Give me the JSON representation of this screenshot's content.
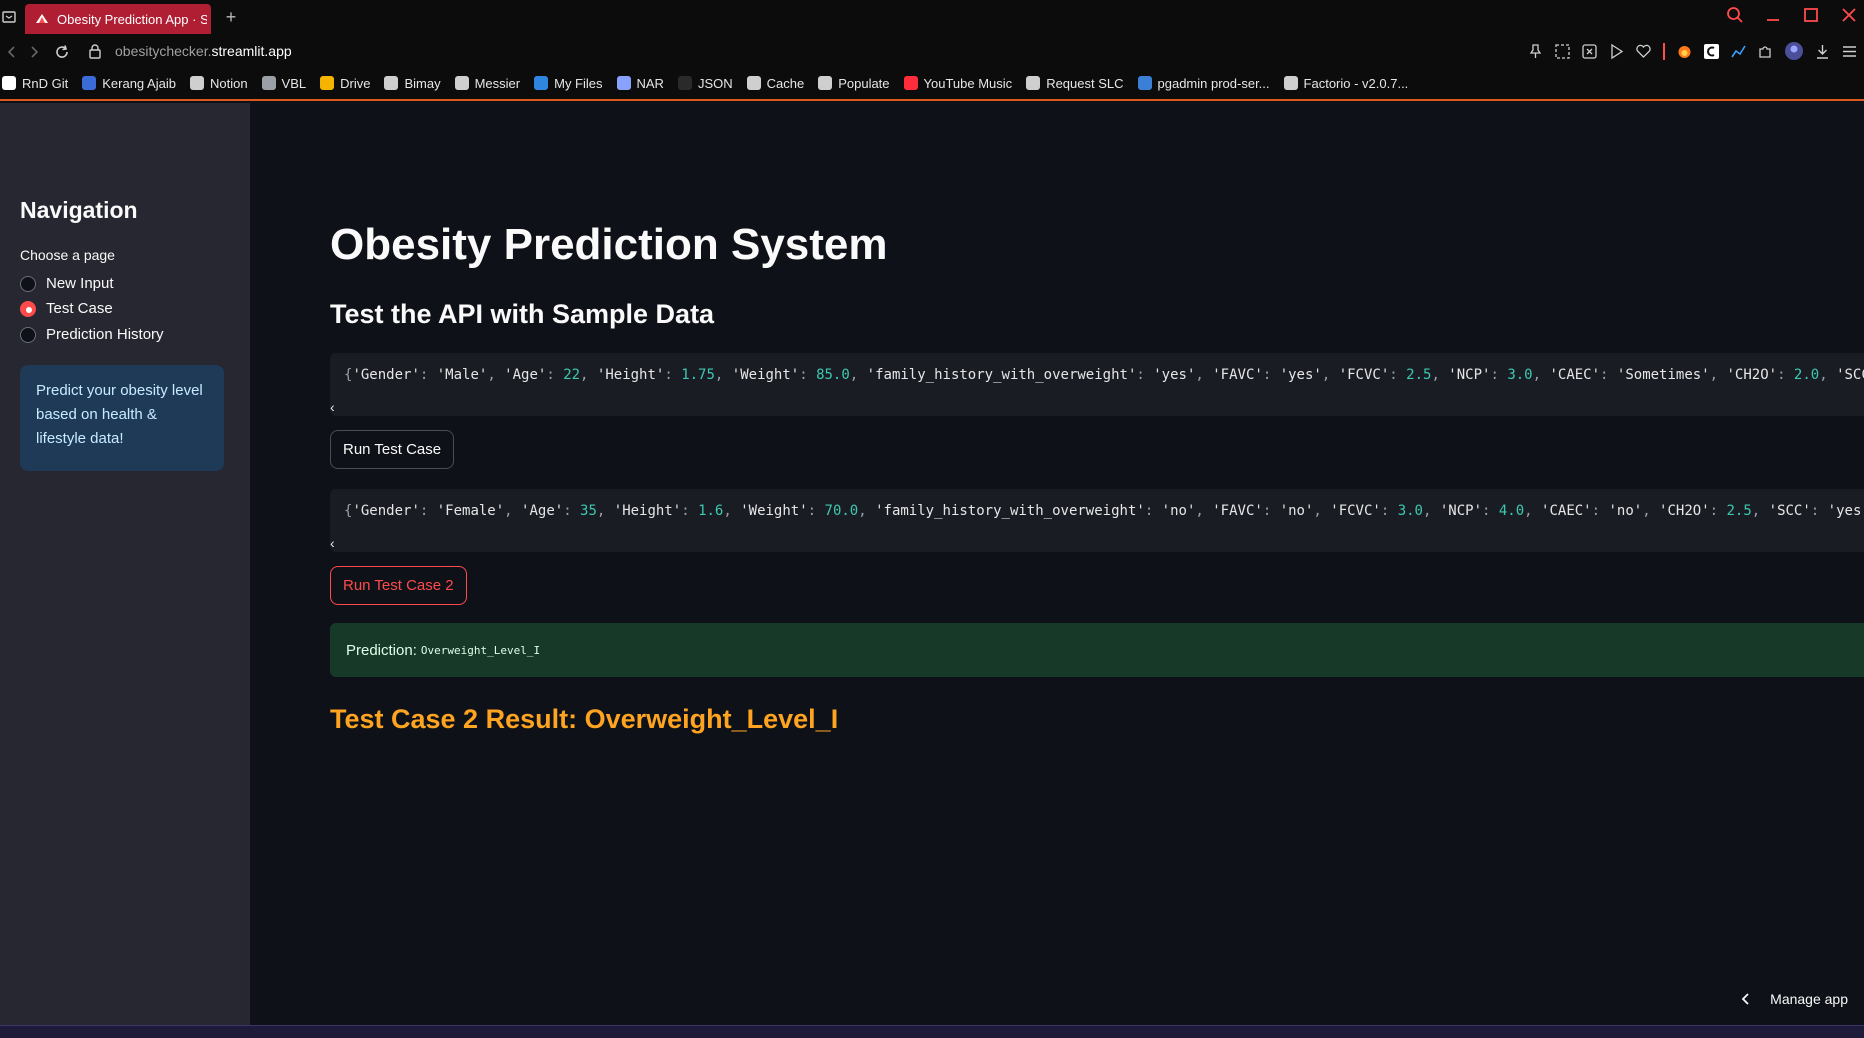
{
  "browser": {
    "tab_title": "Obesity Prediction App · S",
    "new_tab": "+",
    "url_host": "obesitychecker.",
    "url_domain": "streamlit.app",
    "bookmarks": [
      {
        "label": "RnD Git",
        "icon": "github-icon",
        "color": "#ffffff"
      },
      {
        "label": "Kerang Ajaib",
        "icon": "app-icon",
        "color": "#3b6bd6"
      },
      {
        "label": "Notion",
        "icon": "home-icon",
        "color": "#cfcfcf"
      },
      {
        "label": "VBL",
        "icon": "cube-icon",
        "color": "#9aa0a6"
      },
      {
        "label": "Drive",
        "icon": "drive-icon",
        "color": "#f4b400"
      },
      {
        "label": "Bimay",
        "icon": "globe-icon",
        "color": "#cfcfcf"
      },
      {
        "label": "Messier",
        "icon": "globe-icon",
        "color": "#cfcfcf"
      },
      {
        "label": "My Files",
        "icon": "cloud-icon",
        "color": "#2f86e0"
      },
      {
        "label": "NAR",
        "icon": "gear-icon",
        "color": "#8aa2ff"
      },
      {
        "label": "JSON",
        "icon": "json-icon",
        "color": "#2a2a2a"
      },
      {
        "label": "Cache",
        "icon": "globe-icon",
        "color": "#cfcfcf"
      },
      {
        "label": "Populate",
        "icon": "globe-icon",
        "color": "#cfcfcf"
      },
      {
        "label": "YouTube Music",
        "icon": "youtube-music-icon",
        "color": "#ff2d3b"
      },
      {
        "label": "Request SLC",
        "icon": "globe-icon",
        "color": "#cfcfcf"
      },
      {
        "label": "pgadmin prod-ser...",
        "icon": "pgadmin-icon",
        "color": "#3b7fd6"
      },
      {
        "label": "Factorio - v2.0.7...",
        "icon": "file-icon",
        "color": "#cfcfcf"
      }
    ]
  },
  "sidebar": {
    "title": "Navigation",
    "choose_label": "Choose a page",
    "options": [
      {
        "label": "New Input",
        "selected": false
      },
      {
        "label": "Test Case",
        "selected": true
      },
      {
        "label": "Prediction History",
        "selected": false
      }
    ],
    "info": "Predict your obesity level based on health & lifestyle data!"
  },
  "main": {
    "title": "Obesity Prediction System",
    "subheader": "Test the API with Sample Data",
    "test_case_1": {
      "tokens": [
        [
          "p",
          "{"
        ],
        [
          "s",
          "'Gender'"
        ],
        [
          "p",
          ": "
        ],
        [
          "s",
          "'Male'"
        ],
        [
          "p",
          ", "
        ],
        [
          "s",
          "'Age'"
        ],
        [
          "p",
          ": "
        ],
        [
          "n",
          "22"
        ],
        [
          "p",
          ", "
        ],
        [
          "s",
          "'Height'"
        ],
        [
          "p",
          ": "
        ],
        [
          "n",
          "1.75"
        ],
        [
          "p",
          ", "
        ],
        [
          "s",
          "'Weight'"
        ],
        [
          "p",
          ": "
        ],
        [
          "n",
          "85.0"
        ],
        [
          "p",
          ", "
        ],
        [
          "s",
          "'family_history_with_overweight'"
        ],
        [
          "p",
          ": "
        ],
        [
          "s",
          "'yes'"
        ],
        [
          "p",
          ", "
        ],
        [
          "s",
          "'FAVC'"
        ],
        [
          "p",
          ": "
        ],
        [
          "s",
          "'yes'"
        ],
        [
          "p",
          ", "
        ],
        [
          "s",
          "'FCVC'"
        ],
        [
          "p",
          ": "
        ],
        [
          "n",
          "2.5"
        ],
        [
          "p",
          ", "
        ],
        [
          "s",
          "'NCP'"
        ],
        [
          "p",
          ": "
        ],
        [
          "n",
          "3.0"
        ],
        [
          "p",
          ", "
        ],
        [
          "s",
          "'CAEC'"
        ],
        [
          "p",
          ": "
        ],
        [
          "s",
          "'Sometimes'"
        ],
        [
          "p",
          ", "
        ],
        [
          "s",
          "'CH2O'"
        ],
        [
          "p",
          ": "
        ],
        [
          "n",
          "2.0"
        ],
        [
          "p",
          ", "
        ],
        [
          "s",
          "'SCC"
        ]
      ],
      "button": "Run Test Case"
    },
    "test_case_2": {
      "tokens": [
        [
          "p",
          "{"
        ],
        [
          "s",
          "'Gender'"
        ],
        [
          "p",
          ": "
        ],
        [
          "s",
          "'Female'"
        ],
        [
          "p",
          ", "
        ],
        [
          "s",
          "'Age'"
        ],
        [
          "p",
          ": "
        ],
        [
          "n",
          "35"
        ],
        [
          "p",
          ", "
        ],
        [
          "s",
          "'Height'"
        ],
        [
          "p",
          ": "
        ],
        [
          "n",
          "1.6"
        ],
        [
          "p",
          ", "
        ],
        [
          "s",
          "'Weight'"
        ],
        [
          "p",
          ": "
        ],
        [
          "n",
          "70.0"
        ],
        [
          "p",
          ", "
        ],
        [
          "s",
          "'family_history_with_overweight'"
        ],
        [
          "p",
          ": "
        ],
        [
          "s",
          "'no'"
        ],
        [
          "p",
          ", "
        ],
        [
          "s",
          "'FAVC'"
        ],
        [
          "p",
          ": "
        ],
        [
          "s",
          "'no'"
        ],
        [
          "p",
          ", "
        ],
        [
          "s",
          "'FCVC'"
        ],
        [
          "p",
          ": "
        ],
        [
          "n",
          "3.0"
        ],
        [
          "p",
          ", "
        ],
        [
          "s",
          "'NCP'"
        ],
        [
          "p",
          ": "
        ],
        [
          "n",
          "4.0"
        ],
        [
          "p",
          ", "
        ],
        [
          "s",
          "'CAEC'"
        ],
        [
          "p",
          ": "
        ],
        [
          "s",
          "'no'"
        ],
        [
          "p",
          ", "
        ],
        [
          "s",
          "'CH2O'"
        ],
        [
          "p",
          ": "
        ],
        [
          "n",
          "2.5"
        ],
        [
          "p",
          ", "
        ],
        [
          "s",
          "'SCC'"
        ],
        [
          "p",
          ": "
        ],
        [
          "s",
          "'yes'"
        ]
      ],
      "button": "Run Test Case 2"
    },
    "prediction_label": "Prediction:",
    "prediction_value": "Overweight_Level_I",
    "result_heading": "Test Case 2 Result: Overweight_Level_I",
    "scroll_left": "‹",
    "manage_app": "Manage app"
  },
  "colors": {
    "accent": "#ff4b4b",
    "result_orange": "#ffa421",
    "success_bg": "#173928",
    "info_bg": "#1e3a57"
  }
}
